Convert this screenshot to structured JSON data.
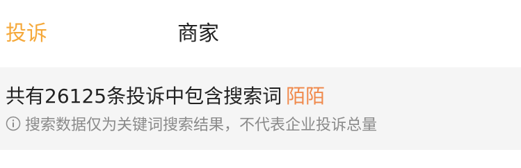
{
  "tabs": {
    "active_label": "投诉",
    "inactive_label": "商家"
  },
  "result": {
    "summary_text": "共有26125条投诉中包含搜索词",
    "keyword": "陌陌",
    "note": "搜索数据仅为关键词搜索结果，不代表企业投诉总量",
    "note_icon": "info-icon"
  },
  "colors": {
    "active_tab": "#f5a93b",
    "keyword": "#f0894b",
    "panel_background": "#f5f5f5",
    "note_text": "#8a8a8a"
  }
}
